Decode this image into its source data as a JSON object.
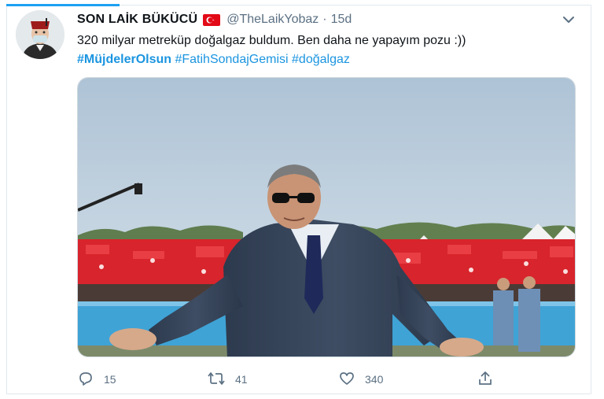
{
  "tweet": {
    "display_name": "SON LAİK BÜKÜCÜ",
    "handle": "@TheLaikYobaz",
    "separator": "·",
    "time": "15d",
    "text": "320 milyar metreküp doğalgaz buldum. Ben daha ne yapayım pozu :))",
    "hashtags": [
      "#MüjdelerOlsun",
      "#FatihSondajGemisi",
      "#doğalgaz"
    ]
  },
  "actions": {
    "replies": "15",
    "retweets": "41",
    "likes": "340"
  },
  "icons": {
    "flag": "turkey-flag-icon",
    "more": "chevron-down-icon",
    "reply": "reply-icon",
    "retweet": "retweet-icon",
    "like": "heart-icon",
    "share": "share-icon"
  },
  "colors": {
    "accent": "#1da1f2",
    "hashtag": "#1b95e0",
    "muted": "#5b7083",
    "flag_red": "#e30a17"
  }
}
